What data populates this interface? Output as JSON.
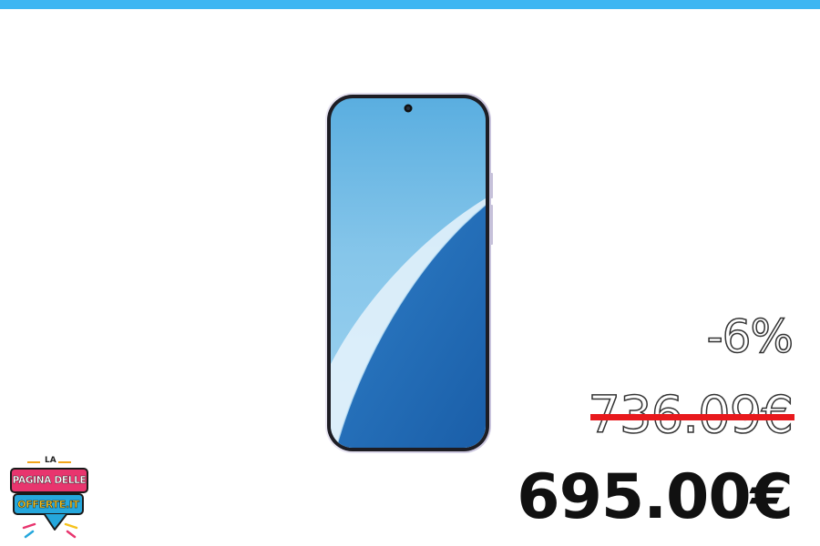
{
  "accent_bar_color": "#3db6f2",
  "product": {
    "image": "smartphone-front-blue-wallpaper",
    "frame_color": "#d8d4e8",
    "screen_colors": [
      "#7cc3ea",
      "#1d63b0"
    ]
  },
  "pricing": {
    "discount": "-6%",
    "old_price": "736.09€",
    "new_price": "695.00€",
    "strike_color": "#e8191d"
  },
  "logo": {
    "line1": "LA",
    "line2": "PAGINA DELLE",
    "line3": "OFFERTE.IT",
    "colors": {
      "top": "#e8356e",
      "bottom": "#25a7dc",
      "text_bottom": "#f6c21c"
    }
  }
}
